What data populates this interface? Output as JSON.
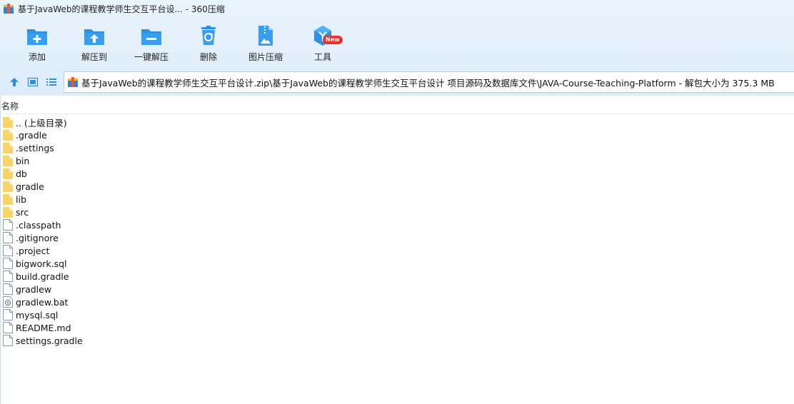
{
  "window": {
    "title": "基于JavaWeb的课程教学师生交互平台设... - 360压缩"
  },
  "toolbar": {
    "items": [
      {
        "label": "添加",
        "icon": "add-folder-icon"
      },
      {
        "label": "解压到",
        "icon": "extract-to-icon"
      },
      {
        "label": "一键解压",
        "icon": "one-click-extract-icon"
      },
      {
        "label": "删除",
        "icon": "recycle-delete-icon"
      },
      {
        "label": "图片压缩",
        "icon": "image-compress-icon"
      },
      {
        "label": "工具",
        "icon": "tools-icon"
      }
    ],
    "badge": "New",
    "accent": "#2d8fde"
  },
  "address": {
    "path": "基于JavaWeb的课程教学师生交互平台设计.zip\\基于JavaWeb的课程教学师生交互平台设计 项目源码及数据库文件\\JAVA-Course-Teaching-Platform - 解包大小为 375.3 MB"
  },
  "filelist": {
    "column_name": "名称",
    "items": [
      {
        "name": ".. (上级目录)",
        "type": "folder"
      },
      {
        "name": ".gradle",
        "type": "folder"
      },
      {
        "name": ".settings",
        "type": "folder"
      },
      {
        "name": "bin",
        "type": "folder"
      },
      {
        "name": "db",
        "type": "folder"
      },
      {
        "name": "gradle",
        "type": "folder"
      },
      {
        "name": "lib",
        "type": "folder"
      },
      {
        "name": "src",
        "type": "folder"
      },
      {
        "name": ".classpath",
        "type": "file"
      },
      {
        "name": ".gitignore",
        "type": "file"
      },
      {
        "name": ".project",
        "type": "file"
      },
      {
        "name": "bigwork.sql",
        "type": "file"
      },
      {
        "name": "build.gradle",
        "type": "file"
      },
      {
        "name": "gradlew",
        "type": "file"
      },
      {
        "name": "gradlew.bat",
        "type": "bat"
      },
      {
        "name": "mysql.sql",
        "type": "file"
      },
      {
        "name": "README.md",
        "type": "file"
      },
      {
        "name": "settings.gradle",
        "type": "file"
      }
    ]
  }
}
